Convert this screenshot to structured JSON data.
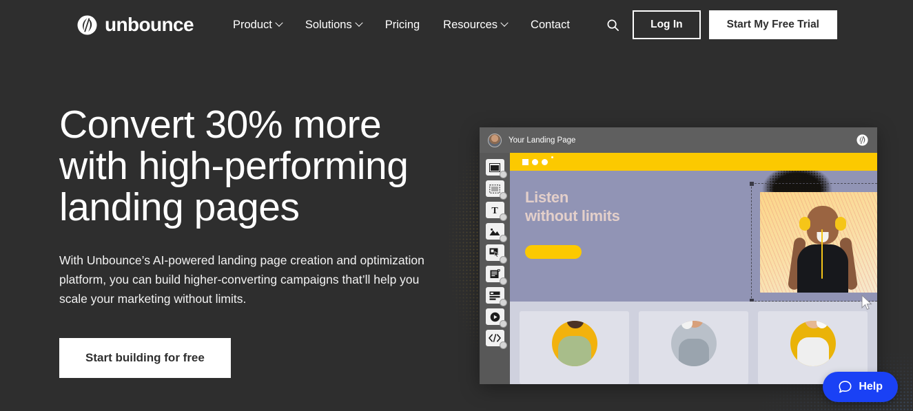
{
  "brand": {
    "name": "unbounce",
    "logo_icon": "unbounce-leaf-circle-icon"
  },
  "nav": {
    "items": [
      {
        "label": "Product",
        "has_caret": true
      },
      {
        "label": "Solutions",
        "has_caret": true
      },
      {
        "label": "Pricing",
        "has_caret": false
      },
      {
        "label": "Resources",
        "has_caret": true
      },
      {
        "label": "Contact",
        "has_caret": false
      }
    ]
  },
  "header_actions": {
    "search_icon": "search-icon",
    "login_label": "Log In",
    "trial_label": "Start My Free Trial"
  },
  "hero": {
    "title_line1": "Convert 30% more",
    "title_line2": "with high-performing",
    "title_line3": "landing pages",
    "subtitle": "With Unbounce’s AI-powered landing page creation and optimization platform, you can build higher-converting campaigns that’ll help you scale your marketing without limits.",
    "cta_label": "Start building for free"
  },
  "mockup": {
    "titlebar": {
      "avatar_icon": "user-avatar",
      "page_title": "Your Landing Page",
      "app_logo_icon": "unbounce-leaf-circle-icon"
    },
    "toolbar": [
      {
        "name": "section-tool",
        "icon": "section-icon"
      },
      {
        "name": "box-tool",
        "icon": "dashed-box-icon"
      },
      {
        "name": "text-tool",
        "icon": "text-t-icon"
      },
      {
        "name": "image-tool",
        "icon": "image-mountain-icon"
      },
      {
        "name": "button-tool",
        "icon": "button-cursor-icon"
      },
      {
        "name": "form-tool",
        "icon": "form-lines-icon"
      },
      {
        "name": "layout-tool",
        "icon": "layout-rows-icon"
      },
      {
        "name": "video-tool",
        "icon": "video-play-icon"
      },
      {
        "name": "code-tool",
        "icon": "code-brackets-icon"
      }
    ],
    "canvas": {
      "hero_heading_line1": "Listen",
      "hero_heading_line2": "without limits",
      "hero_button_label": "",
      "selected_element": "hero-image",
      "cards": [
        {
          "name": "card-1",
          "avatar": "dancing-woman-avatar"
        },
        {
          "name": "card-2",
          "avatar": "headphones-woman-avatar"
        },
        {
          "name": "card-3",
          "avatar": "headphones-man-avatar"
        }
      ]
    }
  },
  "help_widget": {
    "label": "Help",
    "icon": "chat-bubble-icon"
  },
  "colors": {
    "page_background": "#2e2e2e",
    "accent_yellow": "#fcc900",
    "mock_hero_purple": "#9194b5",
    "help_blue": "#1a41f5",
    "white": "#ffffff"
  }
}
